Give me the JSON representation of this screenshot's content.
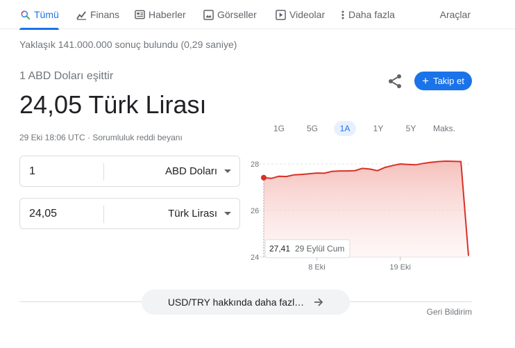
{
  "tabs": [
    {
      "label": "Tümü",
      "icon": "search-icon",
      "active": true
    },
    {
      "label": "Finans",
      "icon": "finance-chart-icon",
      "active": false
    },
    {
      "label": "Haberler",
      "icon": "news-icon",
      "active": false
    },
    {
      "label": "Görseller",
      "icon": "image-icon",
      "active": false
    },
    {
      "label": "Videolar",
      "icon": "video-icon",
      "active": false
    },
    {
      "label": "Daha fazla",
      "icon": "more-vert-icon",
      "active": false
    }
  ],
  "tools_label": "Araçlar",
  "result_stats": "Yaklaşık 141.000.000 sonuç bulundu (0,29 saniye)",
  "converter": {
    "equals_text": "1 ABD Doları eşittir",
    "result_text": "24,05 Türk Lirası",
    "meta_text": "29 Eki 18:06 UTC · Sorumluluk reddi beyanı",
    "follow_label": "Takip et",
    "from_value": "1",
    "from_unit": "ABD Doları",
    "to_value": "24,05",
    "to_unit": "Türk Lirası"
  },
  "range_buttons": [
    {
      "label": "1G",
      "active": false
    },
    {
      "label": "5G",
      "active": false
    },
    {
      "label": "1A",
      "active": true
    },
    {
      "label": "1Y",
      "active": false
    },
    {
      "label": "5Y",
      "active": false
    },
    {
      "label": "Maks.",
      "active": false
    }
  ],
  "tooltip": {
    "value": "27,41",
    "date": "29 Eylül Cum"
  },
  "chart_data": {
    "type": "area",
    "y_ticks": [
      "28",
      "26",
      "24"
    ],
    "x_ticks": [
      "8 Eki",
      "19 Eki"
    ],
    "ylim": [
      24,
      28
    ],
    "values": [
      27.41,
      27.38,
      27.47,
      27.46,
      27.53,
      27.55,
      27.58,
      27.61,
      27.6,
      27.68,
      27.7,
      27.7,
      27.71,
      27.81,
      27.78,
      27.71,
      27.85,
      27.93,
      28.0,
      27.98,
      27.96,
      28.02,
      28.07,
      28.1,
      28.12,
      28.11,
      28.1,
      24.05
    ],
    "line_color": "#d93025",
    "grid": "dashed-horizontal"
  },
  "more_button_label": "USD/TRY hakkında daha fazl…",
  "feedback_label": "Geri Bildirim"
}
